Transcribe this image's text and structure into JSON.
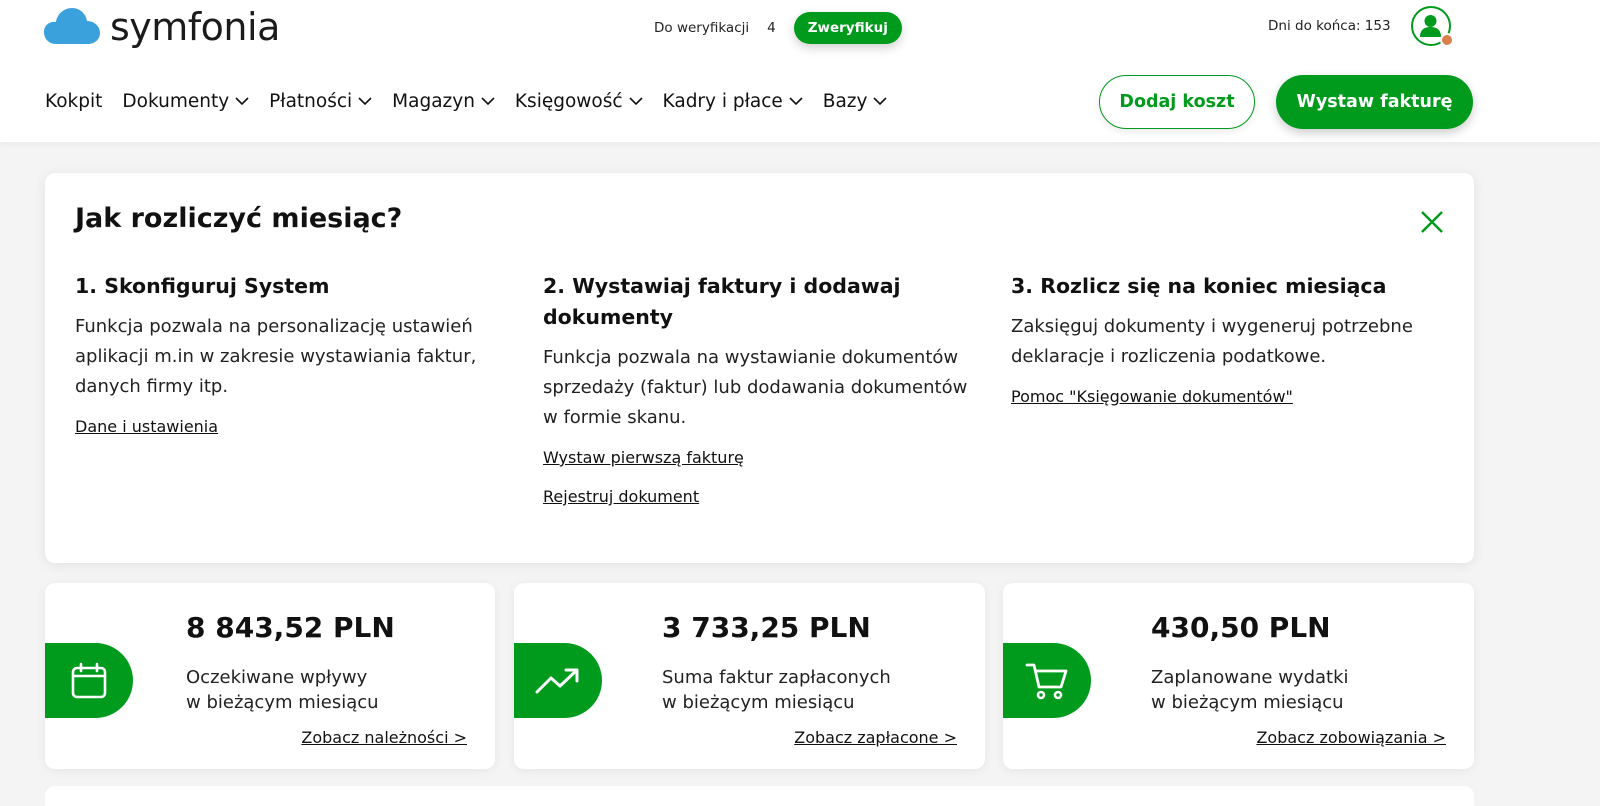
{
  "header": {
    "logo_text": "symfonia",
    "verify_label": "Do weryfikacji",
    "verify_count": "4",
    "verify_button": "Zweryfikuj",
    "days_left": "Dni do końca: 153",
    "add_cost_button": "Dodaj koszt",
    "issue_invoice_button": "Wystaw fakturę",
    "accent_color": "#009b1c"
  },
  "nav": {
    "items": [
      {
        "label": "Kokpit"
      },
      {
        "label": "Dokumenty"
      },
      {
        "label": "Płatności"
      },
      {
        "label": "Magazyn"
      },
      {
        "label": "Księgowość"
      },
      {
        "label": "Kadry i płace"
      },
      {
        "label": "Bazy"
      }
    ]
  },
  "guide": {
    "title": "Jak rozliczyć miesiąc?",
    "steps": [
      {
        "title": "1. Skonfiguruj System",
        "text": "Funkcja pozwala na personalizację ustawień aplikacji m.in w zakresie wystawiania faktur, danych firmy itp.",
        "links": [
          "Dane i ustawienia"
        ]
      },
      {
        "title": "2. Wystawiaj faktury i dodawaj dokumenty",
        "text": "Funkcja pozwala na wystawianie dokumentów sprzedaży (faktur) lub dodawania dokumentów w formie skanu.",
        "links": [
          "Wystaw pierwszą fakturę",
          "Rejestruj dokument"
        ]
      },
      {
        "title": "3. Rozlicz się na koniec miesiąca",
        "text": "Zaksięguj dokumenty i wygeneruj potrzebne deklaracje i rozliczenia podatkowe.",
        "links": [
          "Pomoc \"Księgowanie dokumentów\""
        ]
      }
    ]
  },
  "stats": [
    {
      "icon": "calendar-icon",
      "amount": "8 843,52 PLN",
      "line1": "Oczekiwane wpływy",
      "line2": "w bieżącym miesiącu",
      "link": "Zobacz należności >"
    },
    {
      "icon": "trending-up-icon",
      "amount": "3 733,25 PLN",
      "line1": "Suma faktur zapłaconych",
      "line2": "w bieżącym miesiącu",
      "link": "Zobacz zapłacone >"
    },
    {
      "icon": "cart-icon",
      "amount": "430,50 PLN",
      "line1": "Zaplanowane wydatki",
      "line2": "w bieżącym miesiącu",
      "link": "Zobacz zobowiązania >"
    }
  ]
}
